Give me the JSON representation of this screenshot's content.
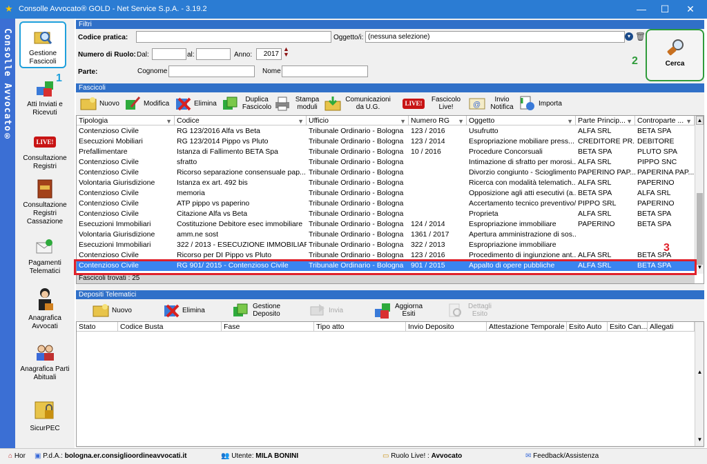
{
  "window": {
    "title": "Consolle Avvocato® GOLD - Net Service S.p.A. - 3.19.2",
    "minimize": "—",
    "maximize": "☐",
    "close": "✕"
  },
  "sidebar": {
    "vertical_title": "Consolle Avvocato®",
    "items": [
      {
        "label": "Gestione Fascicoli",
        "icon": "magnifier-folder-icon"
      },
      {
        "label": "Atti Inviati e Ricevuti",
        "icon": "shapes-icon"
      },
      {
        "label": "Consultazione Registri",
        "icon": "live-registry-icon"
      },
      {
        "label": "Consultazione Registri Cassazione",
        "icon": "live-book-icon"
      },
      {
        "label": "Pagamenti Telematici",
        "icon": "payment-envelope-icon"
      },
      {
        "label": "Anagrafica Avvocati",
        "icon": "lawyer-icon"
      },
      {
        "label": "Anagrafica Parti Abituali",
        "icon": "people-icon"
      },
      {
        "label": "SicurPEC",
        "icon": "pec-lock-folder-icon"
      }
    ]
  },
  "annotations": {
    "n1": "1",
    "n2": "2",
    "n3": "3"
  },
  "filtri": {
    "section_title": "Filtri",
    "codice_pratica_label": "Codice pratica:",
    "codice_pratica_value": "",
    "oggetto_label": "Oggetto/i:",
    "oggetto_value": "(nessuna selezione)",
    "numero_ruolo_label": "Numero di Ruolo:",
    "dal_label": "Dal:",
    "dal_value": "",
    "al_label": "al:",
    "al_value": "",
    "anno_label": "Anno:",
    "anno_value": "2017",
    "parte_label": "Parte:",
    "cognome_label": "Cognome",
    "cognome_value": "",
    "nome_label": "Nome",
    "nome_value": "",
    "cerca_label": "Cerca"
  },
  "fascicoli": {
    "section_title": "Fascicoli",
    "toolbar": [
      {
        "label": "Nuovo",
        "icon": "new-folder-icon"
      },
      {
        "label": "Modifica",
        "icon": "edit-icon"
      },
      {
        "label": "Elimina",
        "icon": "delete-icon"
      },
      {
        "label": "Duplica Fascicolo",
        "icon": "duplicate-icon"
      },
      {
        "label": "Stampa moduli",
        "icon": "printer-icon"
      },
      {
        "label": "Comunicazioni da U.G.",
        "icon": "download-folder-icon"
      },
      {
        "label": "Fascicolo Live!",
        "icon": "live-icon"
      },
      {
        "label": "Invio Notifica",
        "icon": "email-icon"
      },
      {
        "label": "Importa",
        "icon": "import-icon"
      }
    ],
    "columns": [
      "Tipologia",
      "Codice",
      "Ufficio",
      "Numero RG",
      "Oggetto",
      "Parte Princip...",
      "Controparte ..."
    ],
    "rows": [
      [
        "Contenzioso Civile",
        "RG 123/2016 Alfa vs Beta",
        "Tribunale Ordinario - Bologna",
        "123 / 2016",
        "Usufrutto",
        "ALFA SRL",
        "BETA SPA"
      ],
      [
        "Esecuzioni Mobiliari",
        "RG 123/2014 Pippo vs Pluto",
        "Tribunale Ordinario - Bologna",
        "123 / 2014",
        "Espropriazione mobiliare press...",
        "CREDITORE PR...",
        "DEBITORE"
      ],
      [
        "Prefallimentare",
        "Istanza di Fallimento BETA Spa",
        "Tribunale Ordinario - Bologna",
        "10 / 2016",
        "Procedure Concorsuali",
        "BETA SPA",
        "PLUTO SPA"
      ],
      [
        "Contenzioso Civile",
        "sfratto",
        "Tribunale Ordinario - Bologna",
        "",
        "Intimazione di sfratto per morosi...",
        "ALFA SRL",
        "PIPPO SNC"
      ],
      [
        "Contenzioso Civile",
        "Ricorso separazione consensuale pap...",
        "Tribunale Ordinario - Bologna",
        "",
        "Divorzio congiunto - Scioglimento...",
        "PAPERINO PAP...",
        "PAPERINA PAP..."
      ],
      [
        "Volontaria Giurisdizione",
        "Istanza ex art. 492 bis",
        "Tribunale Ordinario - Bologna",
        "",
        "Ricerca con modalità telematich...",
        "ALFA SRL",
        "PAPERINO"
      ],
      [
        "Contenzioso Civile",
        "memoria",
        "Tribunale Ordinario - Bologna",
        "",
        "Opposizione agli atti esecutivi (a...",
        "BETA SPA",
        "ALFA SRL"
      ],
      [
        "Contenzioso Civile",
        "ATP pippo vs paperino",
        "Tribunale Ordinario - Bologna",
        "",
        "Accertamento tecnico preventivo/...",
        "PIPPO SRL",
        "PAPERINO"
      ],
      [
        "Contenzioso Civile",
        "Citazione Alfa vs Beta",
        "Tribunale Ordinario - Bologna",
        "",
        "Proprieta",
        "ALFA SRL",
        "BETA SPA"
      ],
      [
        "Esecuzioni Immobiliari",
        "Costituzione Debitore esec immobiliare",
        "Tribunale Ordinario - Bologna",
        "124 / 2014",
        "Espropriazione immobiliare",
        "PAPERINO",
        "BETA SPA"
      ],
      [
        "Volontaria Giurisdizione",
        "amm.ne sost",
        "Tribunale Ordinario - Bologna",
        "1361 / 2017",
        "Apertura amministrazione di sos...",
        "",
        ""
      ],
      [
        "Esecuzioni Immobiliari",
        "322 / 2013 - ESECUZIONE IMMOBILIAR...",
        "Tribunale Ordinario - Bologna",
        "322 / 2013",
        "Espropriazione immobiliare",
        "",
        ""
      ],
      [
        "Contenzioso Civile",
        "Ricorso per DI Pippo vs Pluto",
        "Tribunale Ordinario - Bologna",
        "123 / 2016",
        "Procedimento di ingiunzione ant...",
        "ALFA SRL",
        "BETA SPA"
      ],
      [
        "Contenzioso Civile",
        "RG 901/ 2015 - Contenzioso Civile",
        "Tribunale Ordinario - Bologna",
        "901 / 2015",
        "Appalto di opere pubbliche",
        "ALFA SRL",
        "BETA SPA"
      ]
    ],
    "count_text": "Fascicoli trovati : 25"
  },
  "depositi": {
    "section_title": "Depositi Telematici",
    "toolbar": [
      {
        "label": "Nuovo",
        "icon": "new-folder-icon"
      },
      {
        "label": "Elimina",
        "icon": "delete-icon"
      },
      {
        "label": "Gestione Deposito",
        "icon": "manage-icon"
      },
      {
        "label": "Invia",
        "icon": "send-icon"
      },
      {
        "label": "Aggiorna Esiti",
        "icon": "refresh-icon"
      },
      {
        "label": "Dettagli Esito",
        "icon": "details-icon"
      }
    ],
    "columns": [
      "Stato",
      "Codice Busta",
      "Fase",
      "Tipo atto",
      "Invio Deposito",
      "Attestazione Temporale",
      "Esito Auto",
      "Esito Can...",
      "Allegati"
    ]
  },
  "statusbar": {
    "home": "Hor",
    "pda_label": "P.d.A.:",
    "pda_value": "bologna.er.consiglioordineavvocati.it",
    "utente_label": "Utente:",
    "utente_value": "MILA BONINI",
    "ruolo_label": "Ruolo Live! :",
    "ruolo_value": "Avvocato",
    "feedback": "Feedback/Assistenza"
  },
  "colors": {
    "titlebar": "#2b7cd3",
    "section_header": "#3070c8",
    "selection": "#3a84f0",
    "annotation_red": "#e0202a",
    "annotation_green": "#2e9b3a",
    "annotation_blue": "#1ea0dc"
  }
}
